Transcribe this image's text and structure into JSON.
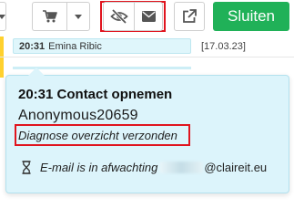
{
  "toolbar": {
    "close_label": "Sluiten"
  },
  "list": {
    "row1": {
      "time": "20:31",
      "name": "Emina Ribic",
      "date": "[17.03.23]"
    }
  },
  "popover": {
    "title": "20:31 Contact opnemen",
    "user": "Anonymous20659",
    "status": "Diagnose overzicht verzonden",
    "email_prefix": "E-mail is in afwachting",
    "email_domain": "@claireit.eu"
  },
  "colors": {
    "accent_green": "#20b158",
    "popover_bg": "#dcf4fb",
    "highlight_red": "#e0141e",
    "row_marker": "#ffd12e"
  },
  "icons": [
    "caret-down-icon",
    "cart-icon",
    "eye-slash-icon",
    "envelope-icon",
    "external-link-icon",
    "hourglass-icon"
  ]
}
